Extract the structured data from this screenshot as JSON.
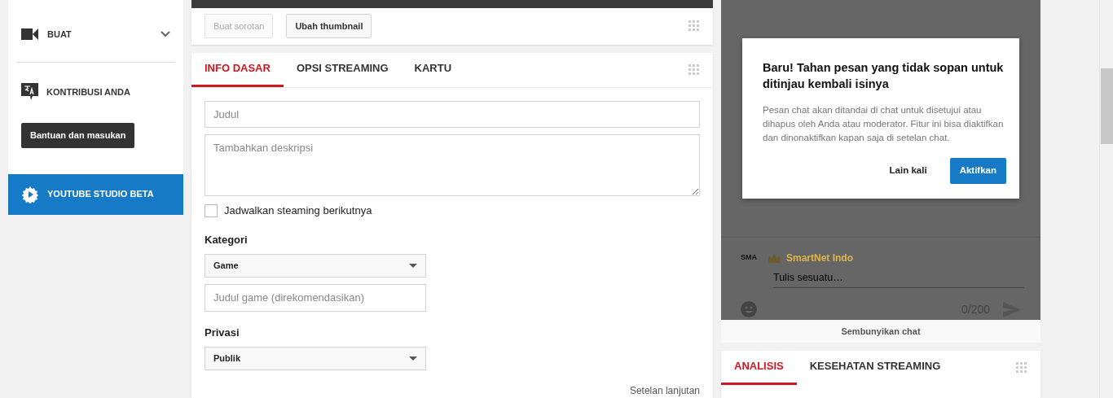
{
  "sidebar": {
    "items": [
      {
        "label": "BUAT",
        "kind": "video",
        "expandable": true
      },
      {
        "label": "KONTRIBUSI ANDA",
        "kind": "translate",
        "expandable": false
      }
    ],
    "help_button": "Bantuan dan masukan",
    "studio_item": {
      "label": "YOUTUBE STUDIO BETA",
      "selected": true
    }
  },
  "video_actions": [
    {
      "label": "Buat sorotan",
      "disabled": true
    },
    {
      "label": "Ubah thumbnail",
      "disabled": false
    }
  ],
  "tabs": [
    {
      "label": "INFO DASAR",
      "selected": true
    },
    {
      "label": "OPSI STREAMING",
      "selected": false
    },
    {
      "label": "KARTU",
      "selected": false
    }
  ],
  "form": {
    "title_placeholder": "Judul",
    "description_placeholder": "Tambahkan deskripsi",
    "schedule": {
      "label": "Jadwalkan steaming berikutnya",
      "checked": false
    },
    "category": {
      "label": "Kategori",
      "value": "Game"
    },
    "game_placeholder": "Judul game (direkomendasikan)",
    "privacy": {
      "label": "Privasi",
      "value": "Publik"
    },
    "advanced_link": "Setelan lanjutan"
  },
  "chat": {
    "dialog": {
      "title": "Baru! Tahan pesan yang tidak sopan untuk ditinjau kembali isinya",
      "body": "Pesan chat akan ditandai di chat untuk disetujui atau dihapus oleh Anda atau moderator. Fitur ini bisa diaktifkan dan dinonaktifkan kapan saja di setelan chat.",
      "buttons": [
        {
          "label": "Lain kali",
          "kind": "text"
        },
        {
          "label": "Aktifkan",
          "kind": "primary"
        }
      ]
    },
    "avatar_text": "SMA",
    "channel_name": "SmartNet Indo",
    "input_placeholder": "Tulis sesuatu…",
    "counter": "0/200",
    "hide_chat": "Sembunyikan chat"
  },
  "bottom_tabs": [
    {
      "label": "ANALISIS",
      "selected": true
    },
    {
      "label": "KESEHATAN STREAMING",
      "selected": false
    }
  ]
}
